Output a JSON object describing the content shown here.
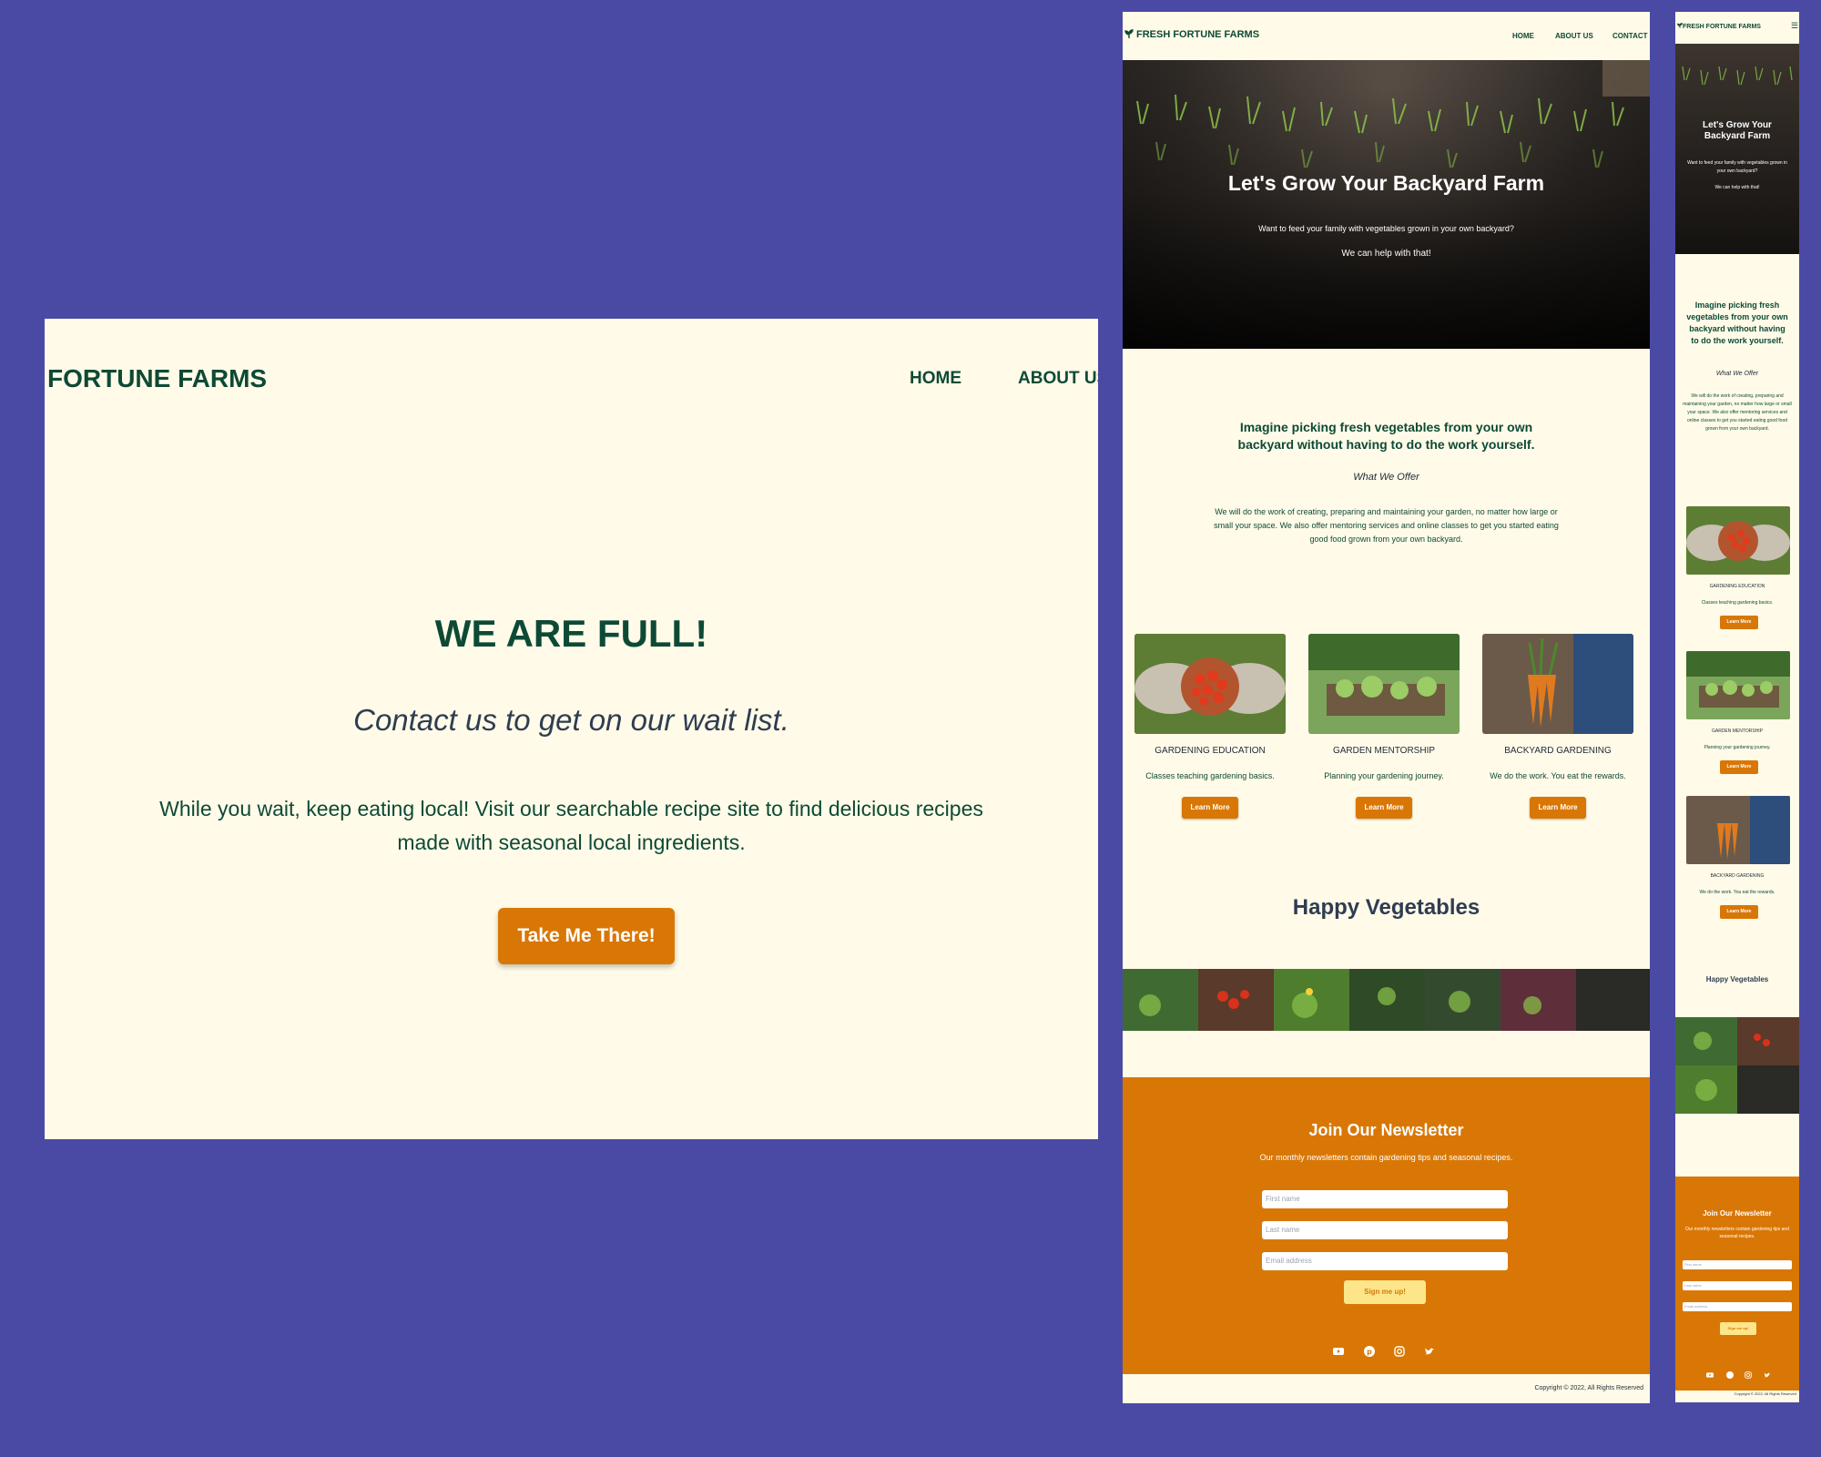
{
  "desktop_waitlist": {
    "brand": "FORTUNE FARMS",
    "nav": [
      "HOME",
      "ABOUT US"
    ],
    "heading": "WE ARE FULL!",
    "subheading": "Contact us to get on our wait list.",
    "body": "While you wait, keep eating local! Visit our searchable recipe site to find delicious recipes made with seasonal local ingredients.",
    "cta": "Take Me There!"
  },
  "tablet": {
    "brand": "FRESH FORTUNE FARMS",
    "nav": [
      "HOME",
      "ABOUT US",
      "CONTACT"
    ],
    "hero": {
      "title": "Let's Grow Your Backyard Farm",
      "line1": "Want to feed your family with vegetables grown in your own backyard?",
      "line2": "We can help with that!"
    },
    "intro": {
      "title": "Imagine picking fresh vegetables from your own backyard without having to do the work yourself.",
      "subtitle": "What We Offer",
      "body": "We will do the work of creating, preparing and maintaining your garden, no matter how large or small your space. We also offer mentoring services and online classes to get you started eating good food grown from your own backyard."
    },
    "cards": [
      {
        "title": "GARDENING EDUCATION",
        "desc": "Classes teaching gardening basics.",
        "button": "Learn More"
      },
      {
        "title": "GARDEN MENTORSHIP",
        "desc": "Planning your gardening journey.",
        "button": "Learn More"
      },
      {
        "title": "BACKYARD GARDENING",
        "desc": "We do the work. You eat the rewards.",
        "button": "Learn More"
      }
    ],
    "gallery_title": "Happy Vegetables",
    "newsletter": {
      "title": "Join Our Newsletter",
      "desc": "Our monthly newsletters contain gardening tips and seasonal recipes.",
      "first_placeholder": "First name",
      "last_placeholder": "Last name",
      "email_placeholder": "Email address",
      "button": "Sign me up!"
    },
    "copyright": "Copyright © 2022, All Rights Reserved"
  },
  "mobile": {
    "brand": "FRESH FORTUNE FARMS",
    "hero": {
      "title": "Let's Grow Your Backyard Farm",
      "line1": "Want to feed your family with vegetables grown in your own backyard?",
      "line2": "We can help with that!"
    },
    "intro": {
      "title": "Imagine picking fresh vegetables from your own backyard without having to do the work yourself.",
      "subtitle": "What We Offer",
      "body": "We will do the work of creating, preparing and maintaining your garden, no matter how large or small your space. We also offer mentoring services and online classes to get you started eating good food grown from your own backyard."
    },
    "cards": [
      {
        "title": "GARDENING EDUCATION",
        "desc": "Classes teaching gardening basics.",
        "button": "Learn More"
      },
      {
        "title": "GARDEN MENTORSHIP",
        "desc": "Planning your gardening journey.",
        "button": "Learn More"
      },
      {
        "title": "BACKYARD GARDENING",
        "desc": "We do the work. You eat the rewards.",
        "button": "Learn More"
      }
    ],
    "gallery_title": "Happy Vegetables",
    "newsletter": {
      "title": "Join Our Newsletter",
      "desc": "Our monthly newsletters contain gardening tips and seasonal recipes.",
      "first_placeholder": "First name",
      "last_placeholder": "Last name",
      "email_placeholder": "Email address",
      "button": "Sign me up!"
    },
    "copyright": "Copyright © 2022, All Rights Reserved"
  },
  "colors": {
    "background": "#4a4aa4",
    "cream": "#fffbe8",
    "green": "#0d4a36",
    "orange": "#d97706"
  },
  "icons": [
    "sprout-icon",
    "menu-icon",
    "youtube-icon",
    "pinterest-icon",
    "instagram-icon",
    "twitter-icon"
  ]
}
